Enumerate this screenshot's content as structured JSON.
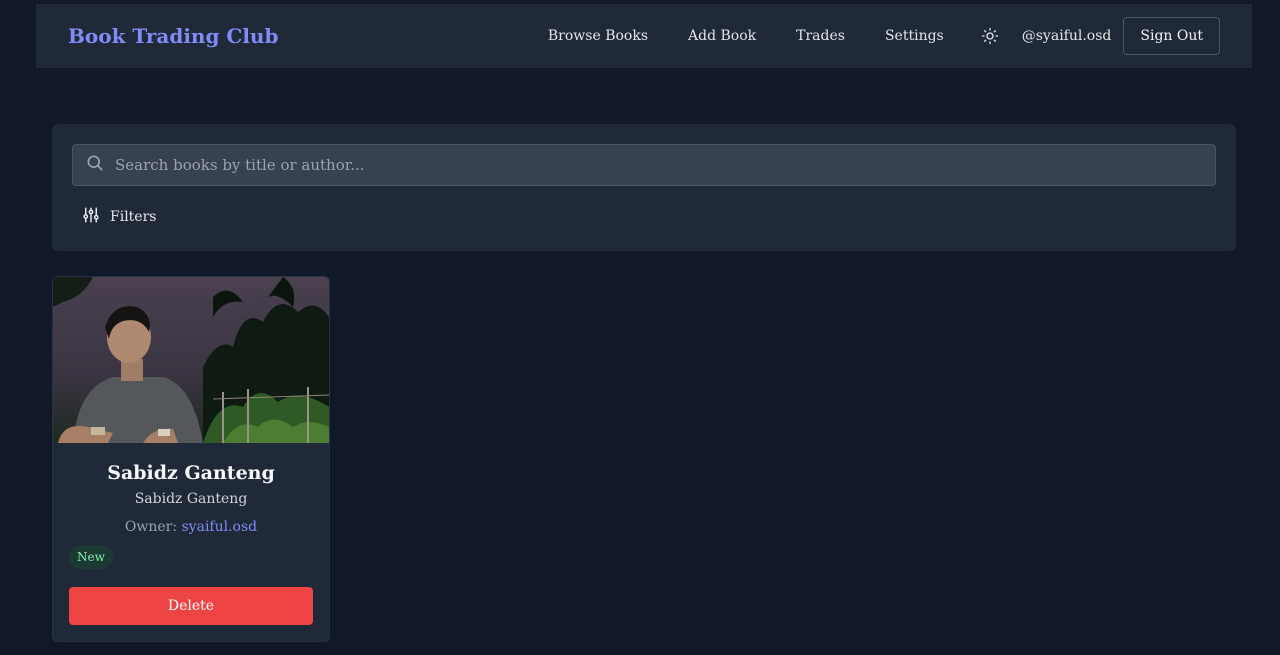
{
  "header": {
    "brand": "Book Trading Club",
    "nav": [
      "Browse Books",
      "Add Book",
      "Trades",
      "Settings"
    ],
    "theme_icon": "sun-icon",
    "username": "@syaiful.osd",
    "signout_label": "Sign Out"
  },
  "search": {
    "placeholder": "Search books by title or author...",
    "value": "",
    "icon": "search-icon",
    "filters_label": "Filters",
    "filters_icon": "sliders-icon"
  },
  "books": [
    {
      "title": "Sabidz Ganteng",
      "author": "Sabidz Ganteng",
      "owner_prefix": "Owner: ",
      "owner": "syaiful.osd",
      "condition": "New",
      "delete_label": "Delete"
    }
  ],
  "colors": {
    "background": "#111827",
    "panel": "#1f2937",
    "accent": "#818cf8",
    "danger": "#ef4444",
    "badge_text": "#86efac"
  }
}
